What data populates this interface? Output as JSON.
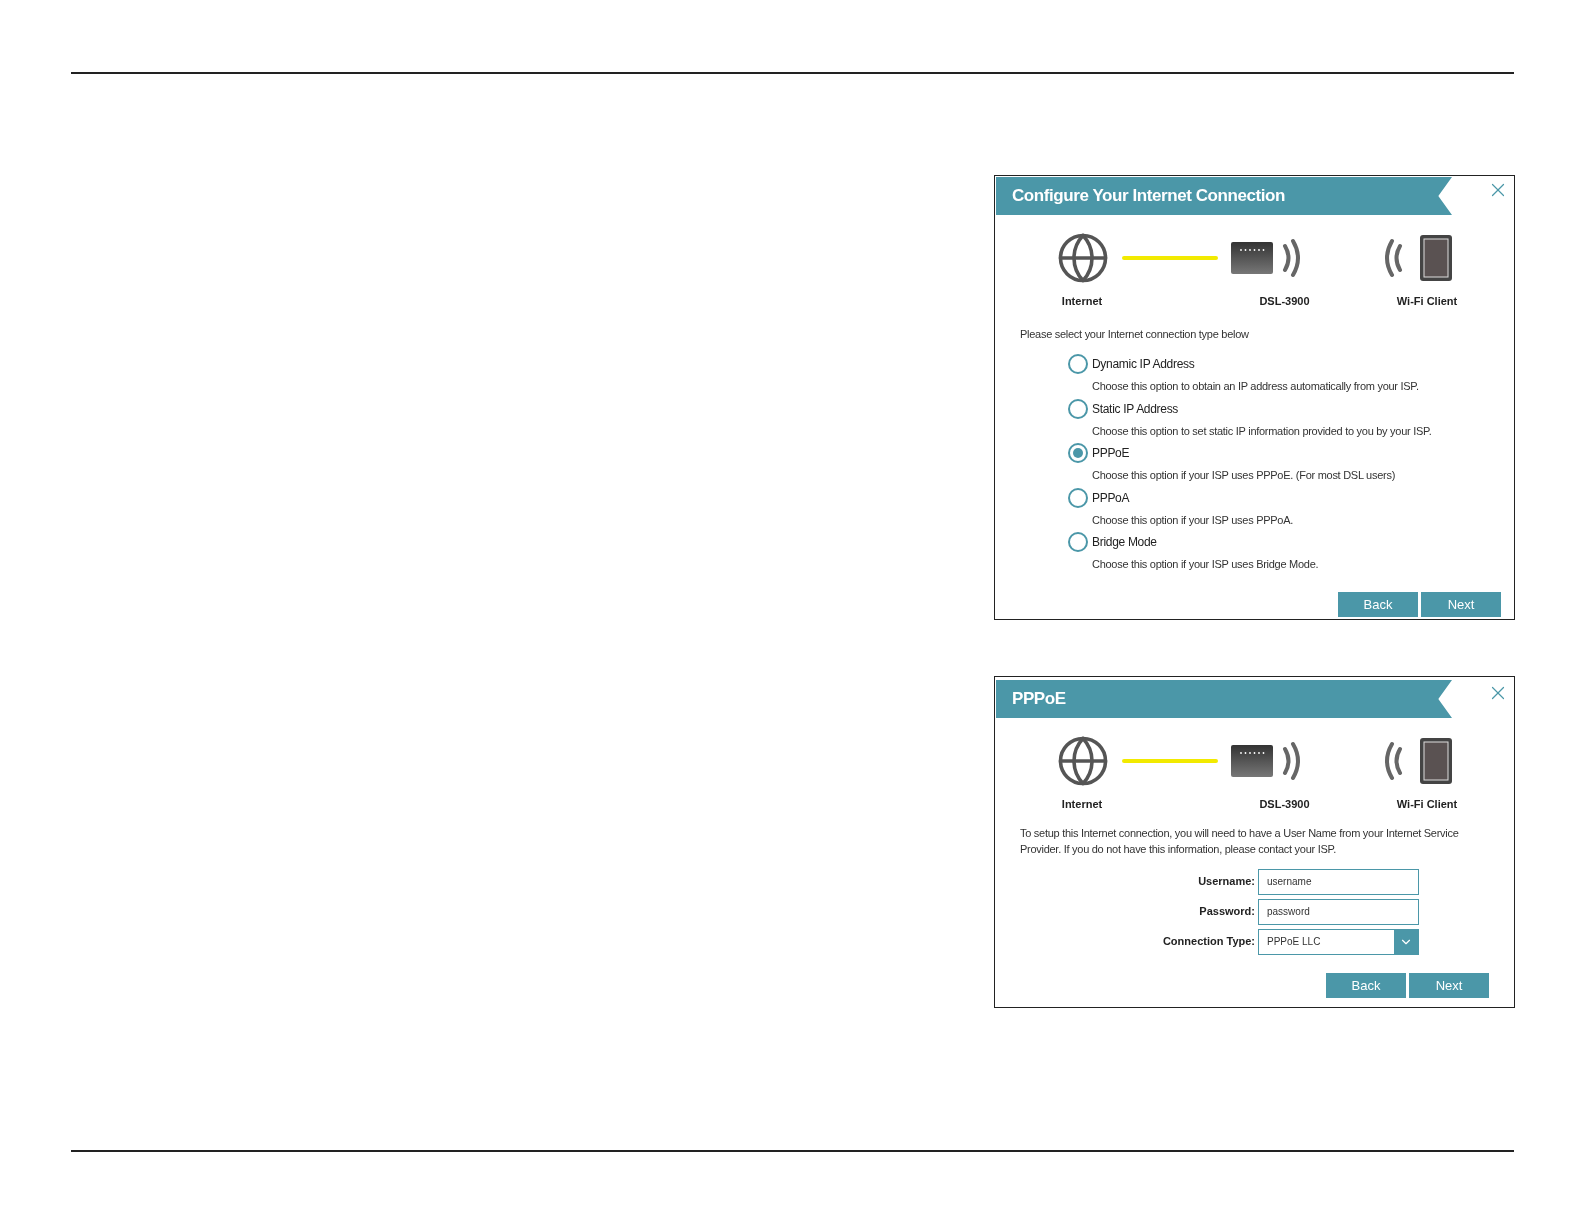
{
  "dialogs": [
    {
      "kind": "connection_type",
      "title": "Configure Your Internet Connection",
      "diagram": {
        "labels": [
          "Internet",
          "DSL-3900",
          "Wi-Fi Client"
        ]
      },
      "prompt": "Please select your Internet connection type below",
      "options": [
        {
          "label": "Dynamic IP Address",
          "description": "Choose this option to obtain an IP address automatically from your ISP.",
          "selected": false
        },
        {
          "label": "Static IP Address",
          "description": "Choose this option to set static IP information provided to you by your ISP.",
          "selected": false
        },
        {
          "label": "PPPoE",
          "description": "Choose this option if your ISP uses PPPoE. (For most DSL users)",
          "selected": true
        },
        {
          "label": "PPPoA",
          "description": "Choose this option if your ISP uses PPPoA.",
          "selected": false
        },
        {
          "label": "Bridge Mode",
          "description": "Choose this option if your ISP uses Bridge Mode.",
          "selected": false
        }
      ],
      "buttons": [
        "Back",
        "Next"
      ]
    },
    {
      "kind": "pppoe",
      "title": "PPPoE",
      "diagram": {
        "labels": [
          "Internet",
          "DSL-3900",
          "Wi-Fi Client"
        ]
      },
      "intro": "To setup this Internet connection, you will need to have a User Name from your Internet Service Provider. If you do not have this information, please contact your ISP.",
      "fields": [
        {
          "kind": "text",
          "label": "Username:",
          "value": "username"
        },
        {
          "kind": "text",
          "label": "Password:",
          "value": "password"
        },
        {
          "kind": "select",
          "label": "Connection Type:",
          "value": "PPPoE LLC"
        }
      ],
      "buttons": [
        "Back",
        "Next"
      ]
    }
  ]
}
